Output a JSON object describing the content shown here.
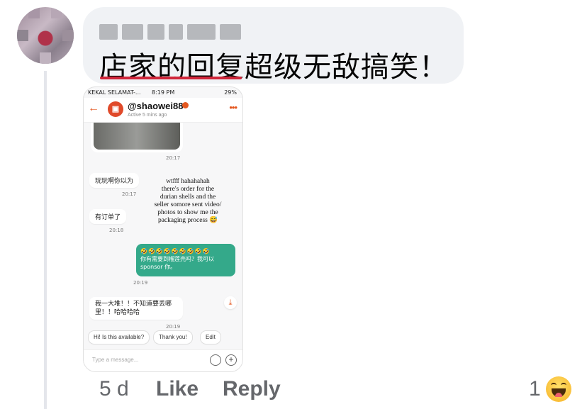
{
  "comment": {
    "author_name": "",
    "text": "店家的回复超级无敌搞笑！"
  },
  "screenshot": {
    "status_left": "KEKAL SELAMAT-... ",
    "status_time": "8:19 PM",
    "status_battery": "29%",
    "chat_name": "@shaowei88",
    "chat_status": "Active 5 mins ago",
    "messages": [
      {
        "time": "20:17"
      },
      {
        "text": "玩玩啊你以为",
        "time": "20:17"
      },
      {
        "text": "有订单了",
        "time": "20:18"
      },
      {
        "text": "你有需要到榴莲壳吗？我可以sponsor 你。",
        "emojis": "🤣🤣🤣🤣🤣🤣🤣🤣🤣",
        "time": "20:19"
      },
      {
        "text": "我一大堆！！不知道要丢哪里！！哈哈哈哈",
        "time": "20:19"
      }
    ],
    "overlay_text": "wtfff hahahahah\nthere's order for the\ndurian shells and the\nseller somore sent video/\nphotos to show me the\npackaging process 😅",
    "quick_replies": [
      "Hi! Is this available?",
      "Thank you!",
      "Edit"
    ],
    "input_placeholder": "Type a message..."
  },
  "footer": {
    "age": "5 d",
    "like_label": "Like",
    "reply_label": "Reply",
    "reaction_count": "1",
    "reaction_icon": "haha-emoji-icon"
  },
  "colors": {
    "bubble_bg": "#f0f2f5",
    "underline": "#d0263a",
    "shopee_orange": "#e4571f",
    "green_bubble": "#34a98a",
    "meta_text": "#65676b"
  }
}
